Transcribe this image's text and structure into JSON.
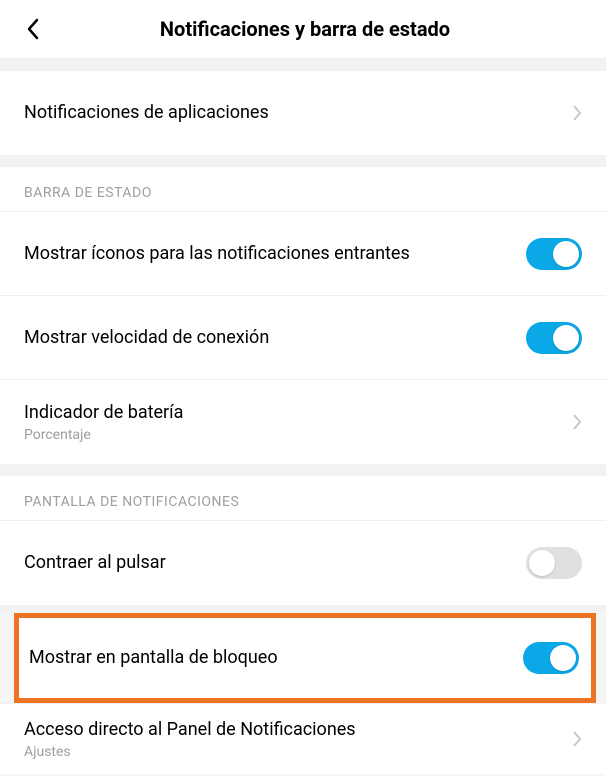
{
  "header": {
    "title": "Notificaciones y barra de estado"
  },
  "rows": {
    "appNotifications": "Notificaciones de aplicaciones"
  },
  "sections": {
    "statusBar": "BARRA DE ESTADO",
    "notificationScreen": "PANTALLA DE NOTIFICACIONES"
  },
  "statusBar": {
    "showIcons": "Mostrar íconos para las notificaciones entrantes",
    "showSpeed": "Mostrar velocidad de conexión",
    "batteryIndicator": "Indicador de batería",
    "batteryIndicatorSub": "Porcentaje"
  },
  "notificationScreen": {
    "collapseOnTap": "Contraer al pulsar",
    "showOnLock": "Mostrar en pantalla de bloqueo",
    "shortcut": "Acceso directo al Panel de Notificaciones",
    "shortcutSub": "Ajustes"
  }
}
